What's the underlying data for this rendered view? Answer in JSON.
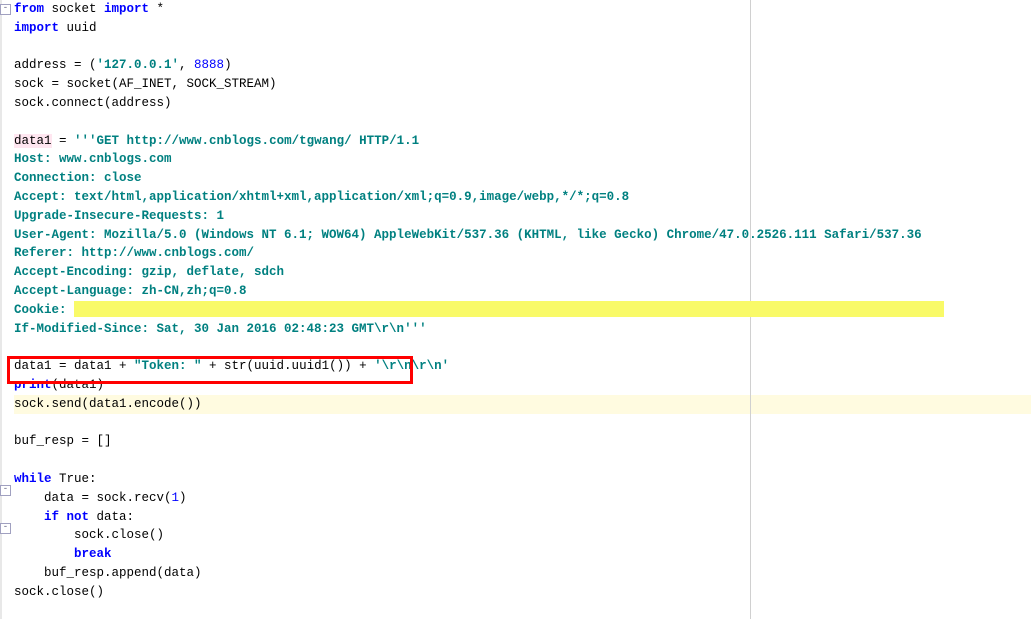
{
  "code": {
    "l01_from": "from",
    "l01_socket": " socket ",
    "l01_import": "import",
    "l01_star": " *",
    "l02_import": "import",
    "l02_uuid": " uuid",
    "l04": "address = (",
    "l04_ip": "'127.0.0.1'",
    "l04_comma": ", ",
    "l04_port": "8888",
    "l04_close": ")",
    "l05": "sock = socket(AF_INET, SOCK_STREAM)",
    "l06": "sock.connect(address)",
    "l08a": "data1",
    "l08b": " = ",
    "l08c": "'''GET http://www.cnblogs.com/tgwang/ HTTP/1.1",
    "l09": "Host: www.cnblogs.com",
    "l10": "Connection: close",
    "l11": "Accept: text/html,application/xhtml+xml,application/xml;q=0.9,image/webp,*/*;q=0.8",
    "l12": "Upgrade-Insecure-Requests: 1",
    "l13": "User-Agent: Mozilla/5.0 (Windows NT 6.1; WOW64) AppleWebKit/537.36 (KHTML, like Gecko) Chrome/47.0.2526.111 Safari/537.36",
    "l14": "Referer: http://www.cnblogs.com/",
    "l15": "Accept-Encoding: gzip, deflate, sdch",
    "l16": "Accept-Language: zh-CN,zh;q=0.8",
    "l17": "Cookie: ",
    "l18": "If-Modified-Since: Sat, 30 Jan 2016 02:48:23 GMT\\r\\n'''",
    "l20a": "data1 = data1 + ",
    "l20b": "\"Token: \"",
    "l20c": " + str(uuid.uuid1()) + ",
    "l20d": "'\\r\\n\\r\\n'",
    "l21a": "print",
    "l21b": "(data1)",
    "l22": "sock.send(data1.encode())",
    "l24": "buf_resp = []",
    "l26_while": "while",
    "l26_rest": " True:",
    "l27": "    data = sock.recv(",
    "l27_num": "1",
    "l27_close": ")",
    "l28_pad": "    ",
    "l28_if": "if",
    "l28_not": " not",
    "l28_rest": " data:",
    "l29": "        sock.close()",
    "l30_pad": "        ",
    "l30_break": "break",
    "l31": "    buf_resp.append(data)",
    "l32": "sock.close()"
  },
  "colors": {
    "keyword": "#0000ff",
    "string": "#008080",
    "highlight_red": "#ff0000",
    "highlight_yellow": "#f9fa68",
    "highlight_line": "#fffbe0",
    "highlight_pink": "#ffe6f0"
  }
}
